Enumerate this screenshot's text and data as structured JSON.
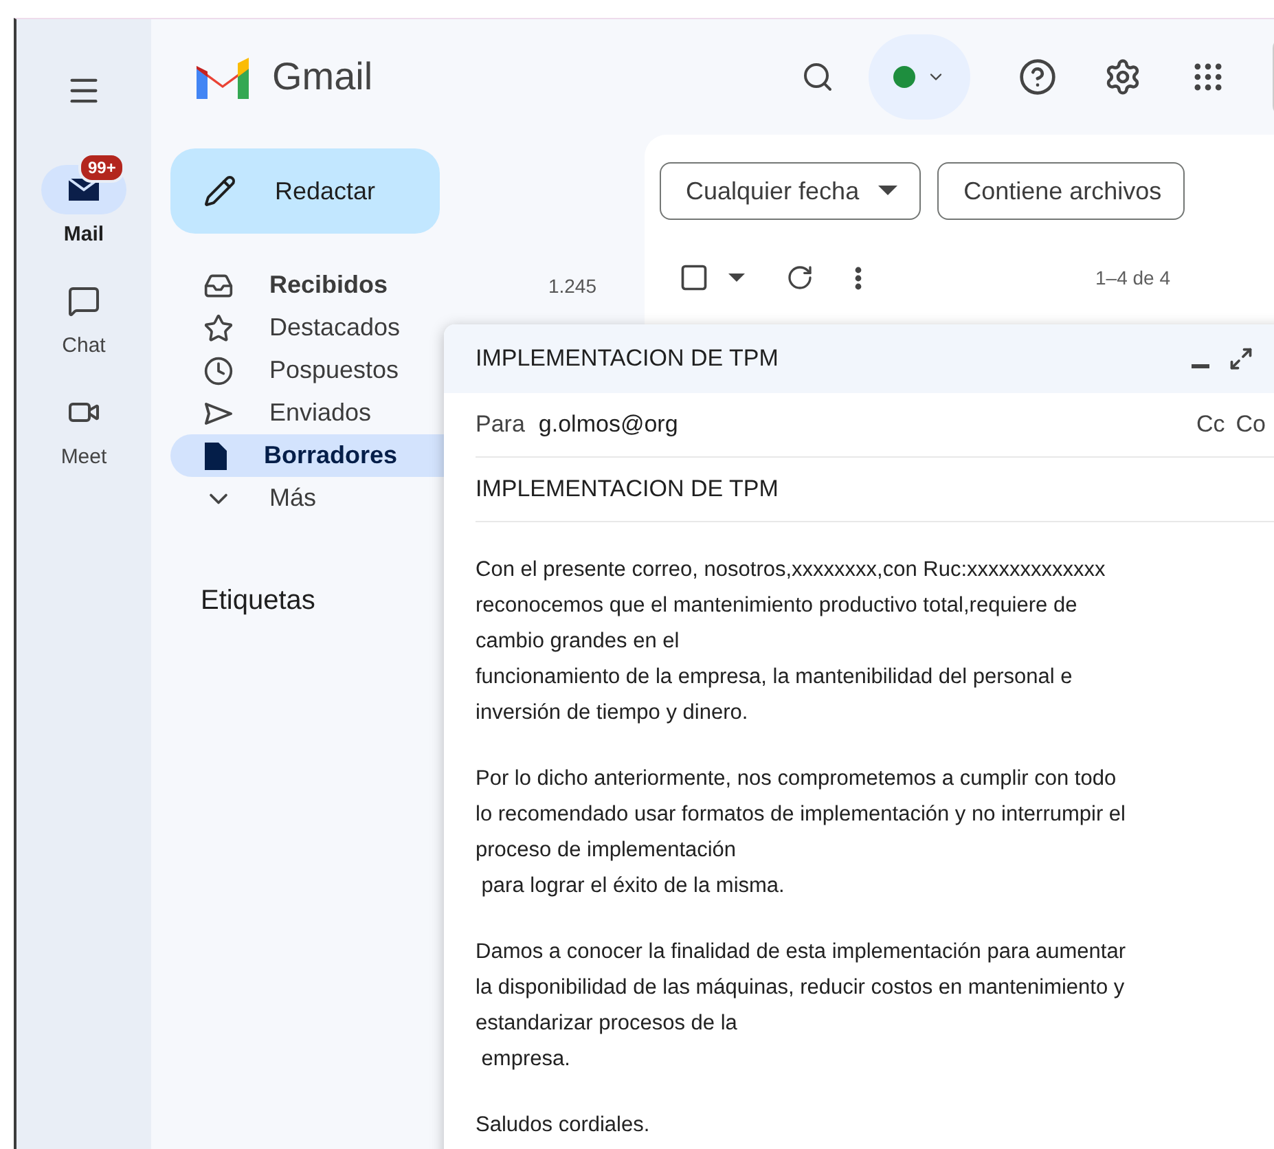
{
  "rail": [
    {
      "label": "Mail",
      "kind": "mail",
      "selected": true,
      "badge": "99+"
    },
    {
      "label": "Chat",
      "kind": "chat",
      "selected": false
    },
    {
      "label": "Meet",
      "kind": "meet",
      "selected": false
    }
  ],
  "brand": "Gmail",
  "status": {
    "color": "#1e8e3e"
  },
  "compose_button": "Redactar",
  "nav": [
    {
      "label": "Recibidos",
      "kind": "inbox",
      "selected": false,
      "unread": true,
      "count": "1.245"
    },
    {
      "label": "Destacados",
      "kind": "star",
      "selected": false,
      "unread": false
    },
    {
      "label": "Pospuestos",
      "kind": "clock",
      "selected": false,
      "unread": false
    },
    {
      "label": "Enviados",
      "kind": "send",
      "selected": false,
      "unread": false
    },
    {
      "label": "Borradores",
      "kind": "draft",
      "selected": true,
      "unread": false
    },
    {
      "label": "Más",
      "kind": "more",
      "selected": false,
      "unread": false
    }
  ],
  "labels_heading": "Etiquetas",
  "filters": [
    {
      "label": "Cualquier fecha",
      "dropdown": true
    },
    {
      "label": "Contiene archivos",
      "dropdown": false
    }
  ],
  "select_all": {
    "checked": false
  },
  "pagination": "1–4 de 4",
  "compose": {
    "title": "IMPLEMENTACION DE TPM",
    "to_label": "Para",
    "to": "g.olmos@org",
    "cc_links": [
      "Cc",
      "Co"
    ],
    "subject": "IMPLEMENTACION DE TPM",
    "body": [
      "Con el presente correo, nosotros,xxxxxxxx,con Ruc:xxxxxxxxxxxxx\nreconocemos que el mantenimiento productivo total,requiere de\ncambio grandes en el\nfuncionamiento de la empresa, la mantenibilidad del personal e\ninversión de tiempo y dinero.",
      "Por lo dicho anteriormente, nos comprometemos a cumplir con todo\nlo recomendado usar formatos de implementación y no interrumpir el\nproceso de implementación\n para lograr el éxito de la misma.",
      "Damos a conocer la finalidad de esta implementación para aumentar\nla disponibilidad de las máquinas, reducir costos en mantenimiento y\nestandarizar procesos de la\n empresa.",
      "Saludos cordiales."
    ]
  }
}
